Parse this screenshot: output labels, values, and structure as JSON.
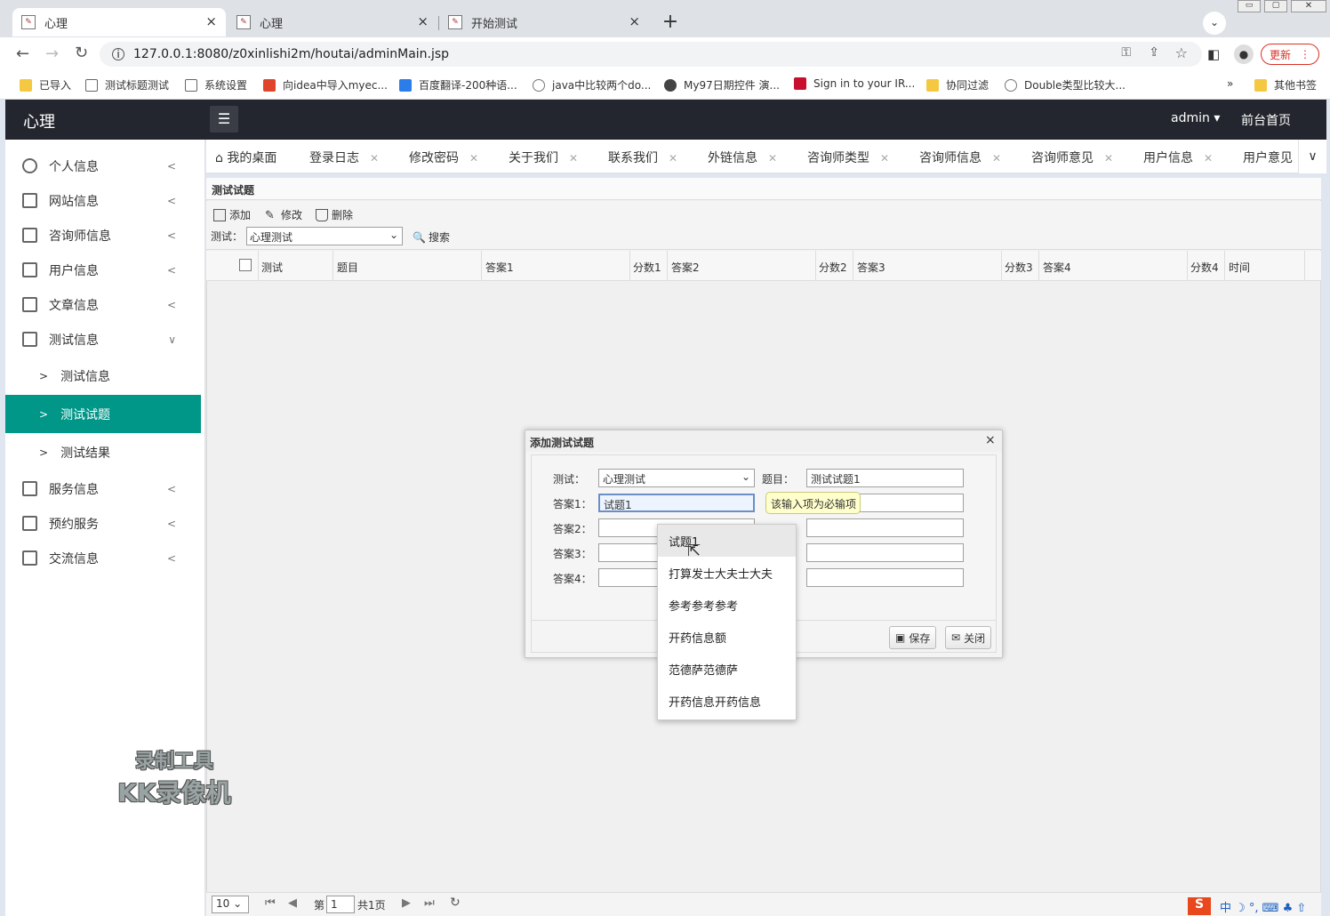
{
  "browser": {
    "tabs": [
      {
        "label": "心理",
        "close": "×"
      },
      {
        "label": "心理",
        "close": "×"
      },
      {
        "label": "开始测试",
        "close": "×"
      }
    ],
    "new_tab": "+",
    "url": "127.0.0.1:8080/z0xinlishi2m/houtai/adminMain.jsp",
    "update_label": "更新",
    "bookmarks": [
      "已导入",
      "测试标题测试",
      "系统设置",
      "向idea中导入myec...",
      "百度翻译-200种语...",
      "java中比较两个do...",
      "My97日期控件 演...",
      "Sign in to your IR...",
      "协同过滤",
      "Double类型比较大..."
    ],
    "bookmarks_more": "»",
    "other_bookmarks": "其他书签"
  },
  "app": {
    "logo": "心理",
    "user": "admin",
    "home_link": "前台首页"
  },
  "sidebar": {
    "items": [
      {
        "label": "个人信息",
        "icon": "user-icon"
      },
      {
        "label": "网站信息",
        "icon": "doc-icon"
      },
      {
        "label": "咨询师信息",
        "icon": "doc-icon"
      },
      {
        "label": "用户信息",
        "icon": "doc-icon"
      },
      {
        "label": "文章信息",
        "icon": "doc-icon"
      },
      {
        "label": "测试信息",
        "icon": "doc-icon"
      },
      {
        "label": "服务信息",
        "icon": "doc-icon"
      },
      {
        "label": "预约服务",
        "icon": "doc-icon"
      },
      {
        "label": "交流信息",
        "icon": "doc-icon"
      }
    ],
    "subitems": [
      "测试信息",
      "测试试题",
      "测试结果"
    ],
    "active_sub": "测试试题"
  },
  "page_tabs": [
    "我的桌面",
    "登录日志",
    "修改密码",
    "关于我们",
    "联系我们",
    "外链信息",
    "咨询师类型",
    "咨询师信息",
    "咨询师意见",
    "用户信息",
    "用户意见"
  ],
  "panel": {
    "title": "测试试题",
    "add": "添加",
    "edit": "修改",
    "delete": "删除",
    "filter_label": "测试：",
    "filter_value": "心理测试",
    "search": "搜索",
    "columns": [
      "测试",
      "题目",
      "答案1",
      "分数1",
      "答案2",
      "分数2",
      "答案3",
      "分数3",
      "答案4",
      "分数4",
      "时间"
    ]
  },
  "pager": {
    "page_size": "10",
    "page_prefix": "第",
    "page": "1",
    "total": "共1页"
  },
  "dialog": {
    "title": "添加测试试题",
    "close": "×",
    "test_label": "测试：",
    "test_value": "心理测试",
    "title_label": "题目：",
    "title_value": "测试试题1",
    "a1_label": "答案1：",
    "a1_value": "试题1",
    "a2_label": "答案2：",
    "a3_label": "答案3：",
    "a4_label": "答案4：",
    "save": "保存",
    "close_btn": "关闭"
  },
  "tooltip": "该输入项为必输项",
  "autocomplete": [
    "试题1",
    "打算发士大夫士大夫",
    "参考参考参考",
    "开药信息额",
    "范德萨范德萨",
    "开药信息开药信息"
  ],
  "watermark": {
    "line1": "录制工具",
    "line2": "KK录像机"
  },
  "colors": {
    "topbar": "#23262e",
    "accent": "#009688",
    "update": "#d93025"
  }
}
